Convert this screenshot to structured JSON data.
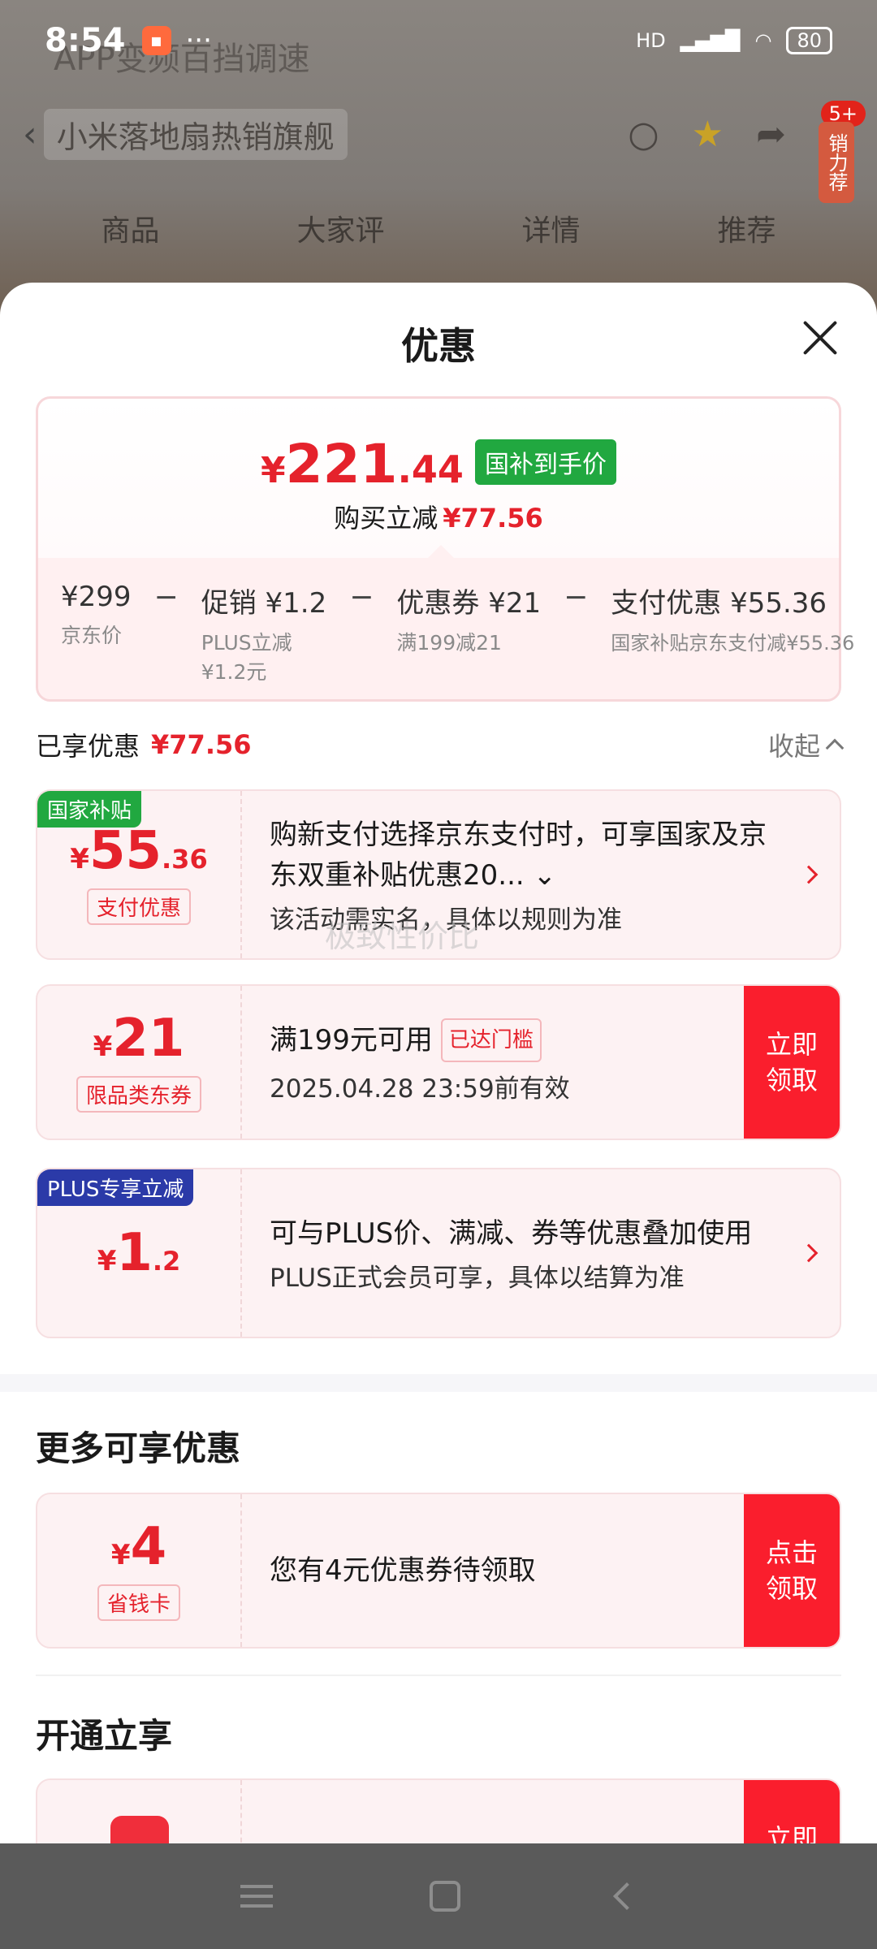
{
  "status_bar": {
    "time": "8:54",
    "more": "···",
    "network": "HD",
    "battery": "80"
  },
  "background": {
    "slogan": "APP变频百挡调速",
    "store_name": "小米落地扇热销旗舰",
    "badge": "5+",
    "side_tag": "销力荐",
    "tabs": [
      "商品",
      "大家评",
      "详情",
      "推荐"
    ]
  },
  "sheet": {
    "title": "优惠",
    "price_card": {
      "currency": "¥",
      "price_int": "221",
      "price_dec": ".44",
      "tag": "国补到手价",
      "save_label": "购买立减",
      "save_amount": "¥77.56",
      "breakdown": [
        {
          "value": "¥299",
          "sub": "京东价"
        },
        {
          "value": "促销 ¥1.2",
          "sub": "PLUS立减\n¥1.2元"
        },
        {
          "value": "优惠券 ¥21",
          "sub": "满199减21"
        },
        {
          "value": "支付优惠 ¥55.36",
          "sub": "国家补贴京东支付减¥55.36"
        }
      ],
      "operator": "−"
    },
    "enjoyed": {
      "label": "已享优惠",
      "amount": "¥77.56",
      "collapse_label": "收起"
    },
    "coupons": [
      {
        "corner": "国家补贴",
        "corner_color": "#21a840",
        "currency": "¥",
        "amount_int": "55",
        "amount_dec": ".36",
        "label": "支付优惠",
        "main": "购新支付选择京东支付时，可享国家及京东双重补贴优惠20... ⌄",
        "sub": "该活动需实名，具体以规则为准"
      },
      {
        "currency": "¥",
        "amount_int": "21",
        "label": "限品类东券",
        "main": "满199元可用",
        "reached": "已达门槛",
        "sub": "2025.04.28 23:59前有效",
        "action": "立即领取"
      },
      {
        "corner": "PLUS专享立减",
        "corner_color": "#2b3aa8",
        "currency": "¥",
        "amount_int": "1",
        "amount_dec": ".2",
        "main": "可与PLUS价、满减、券等优惠叠加使用",
        "sub": "PLUS正式会员可享，具体以结算为准"
      }
    ],
    "watermark": "极致性价比",
    "more_title": "更多可享优惠",
    "more_coupon": {
      "currency": "¥",
      "amount_int": "4",
      "label": "省钱卡",
      "main": "您有4元优惠券待领取",
      "action": "点击领取"
    },
    "open_title": "开通立享",
    "open_action": "立即"
  }
}
